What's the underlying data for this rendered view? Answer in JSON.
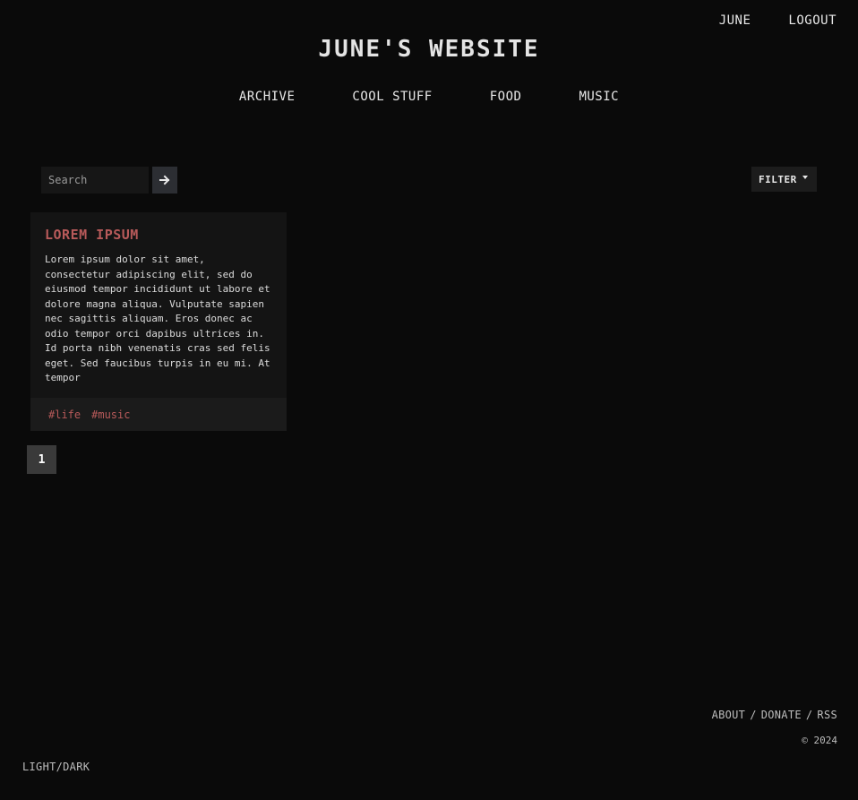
{
  "header": {
    "user_name": "JUNE",
    "logout_label": "LOGOUT",
    "site_title": "JUNE'S WEBSITE"
  },
  "nav": {
    "items": [
      {
        "label": "ARCHIVE"
      },
      {
        "label": "COOL STUFF"
      },
      {
        "label": "FOOD"
      },
      {
        "label": "MUSIC"
      }
    ]
  },
  "search": {
    "placeholder": "Search",
    "value": "",
    "submit_icon": "arrow-right-icon"
  },
  "filter": {
    "label": "FILTER",
    "icon": "chevron-down-icon"
  },
  "posts": [
    {
      "title": "LOREM IPSUM",
      "excerpt": "Lorem ipsum dolor sit amet, consectetur adipiscing elit, sed do eiusmod tempor incididunt ut labore et dolore magna aliqua. Vulputate sapien nec sagittis aliquam. Eros donec ac odio tempor orci dapibus ultrices in. Id porta nibh venenatis cras sed felis eget. Sed faucibus turpis in eu mi. At tempor",
      "tags": [
        "#life",
        "#music"
      ]
    }
  ],
  "pagination": {
    "current_page": "1"
  },
  "footer": {
    "links": [
      {
        "label": "ABOUT"
      },
      {
        "label": "DONATE"
      },
      {
        "label": "RSS"
      }
    ],
    "separator": "/",
    "copyright": "© 2024",
    "theme_toggle": "LIGHT/DARK"
  },
  "colors": {
    "background": "#0a0a0a",
    "accent": "#b85a5a",
    "card": "#141414",
    "text": "#e8e8e8"
  }
}
